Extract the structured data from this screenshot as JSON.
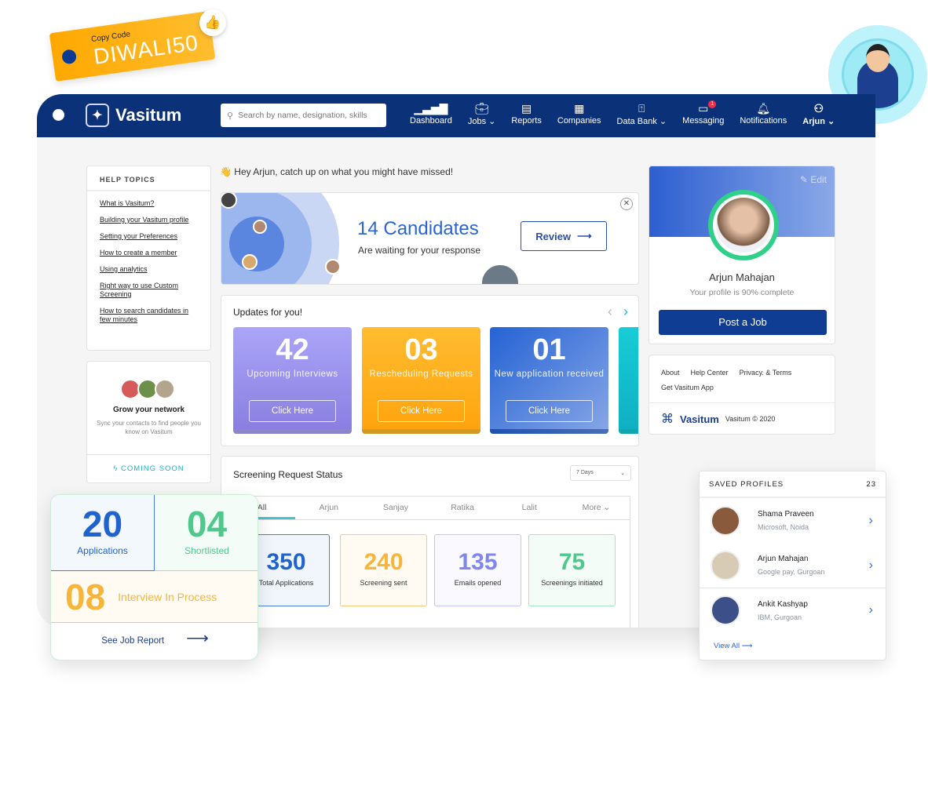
{
  "coupon": {
    "label": "Copy Code",
    "code": "DIWALI50"
  },
  "nav": {
    "brand": "Vasitum",
    "search_placeholder": "Search by name, designation, skills",
    "items": [
      {
        "label": "Dashboard"
      },
      {
        "label": "Jobs ⌄"
      },
      {
        "label": "Reports"
      },
      {
        "label": "Companies"
      },
      {
        "label": "Data Bank ⌄"
      },
      {
        "label": "Messaging",
        "badge": "1"
      },
      {
        "label": "Notifications"
      },
      {
        "label": "Arjun ⌄"
      }
    ]
  },
  "help": {
    "title": "HELP TOPICS",
    "links": [
      "What is Vasitum?",
      "Building your Vasitum profile",
      "Setting your Preferences",
      "How to create a member",
      "Using analytics",
      "Right way to use Custom Screening",
      "How to search candidates in few minutes"
    ]
  },
  "network": {
    "title": "Grow your network",
    "desc": "Sync your contacts to find people you know on Vasitum",
    "cta": "COMING SOON"
  },
  "greeting": "Hey Arjun, catch up on what you might have missed!",
  "candidates": {
    "title": "14 Candidates",
    "subtitle": "Are waiting for your response",
    "button": "Review"
  },
  "updates": {
    "title": "Updates for you!",
    "tiles": [
      {
        "num": "42",
        "label": "Upcoming Interviews",
        "button": "Click Here"
      },
      {
        "num": "03",
        "label": "Rescheduling Requests",
        "button": "Click Here"
      },
      {
        "num": "01",
        "label": "New application received",
        "button": "Click Here"
      }
    ]
  },
  "screening": {
    "title": "Screening Request Status",
    "period": "7 Days",
    "tabs": [
      "All",
      "Arjun",
      "Sanjay",
      "Ratika",
      "Lalit",
      "More ⌄"
    ],
    "stats": [
      {
        "num": "350",
        "label": "Total Applications",
        "color": "#1f63d0"
      },
      {
        "num": "240",
        "label": "Screening sent",
        "color": "#f7b53b"
      },
      {
        "num": "135",
        "label": "Emails opened",
        "color": "#7f86ef"
      },
      {
        "num": "75",
        "label": "Screenings initiated",
        "color": "#4ec98b"
      }
    ]
  },
  "profile": {
    "edit": "Edit",
    "name": "Arjun Mahajan",
    "completion": "Your profile is 90% complete",
    "completion_pct": 90,
    "button": "Post a Job"
  },
  "footer": {
    "links": [
      "About",
      "Help Center",
      "Privacy. & Terms",
      "Get Vasitum App"
    ],
    "brand": "Vasitum",
    "copyright": "Vasitum © 2020"
  },
  "saved": {
    "title": "SAVED PROFILES",
    "count": "23",
    "items": [
      {
        "name": "Shama Praveen",
        "org": "Microsoft, Noida"
      },
      {
        "name": "Arjun Mahajan",
        "org": "Google pay, Gurgoan"
      },
      {
        "name": "Ankit Kashyap",
        "org": "IBM, Gurgoan"
      }
    ],
    "view_all": "View All"
  },
  "summary": {
    "applications": {
      "num": "20",
      "label": "Applications"
    },
    "shortlisted": {
      "num": "04",
      "label": "Shortlisted"
    },
    "interview": {
      "num": "08",
      "label": "Interview In Process"
    },
    "report": "See Job Report"
  }
}
